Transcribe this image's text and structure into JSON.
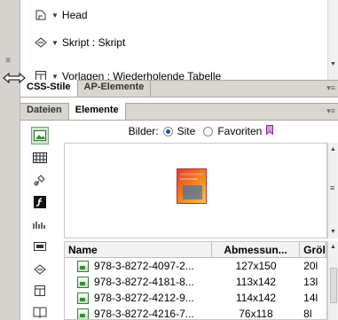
{
  "top_panel": {
    "rows": [
      {
        "icon": "head-tag-icon",
        "label": "Head"
      },
      {
        "icon": "script-icon",
        "label": "Skript : Skript"
      },
      {
        "icon": "template-icon",
        "label": "Vorlagen : Wiederholende Tabelle"
      }
    ]
  },
  "tabs_group1": [
    {
      "label": "CSS-Stile",
      "active": true
    },
    {
      "label": "AP-Elemente",
      "active": false
    }
  ],
  "tabs_group2": [
    {
      "label": "Dateien",
      "active": false
    },
    {
      "label": "Elemente",
      "active": true
    }
  ],
  "assets": {
    "label": "Bilder:",
    "radio_site": "Site",
    "radio_favorites": "Favoriten",
    "selected": "Site",
    "columns": [
      "Name",
      "Abmessun...",
      "Gröl"
    ],
    "rows": [
      {
        "name": "978-3-8272-4097-2...",
        "dims": "127x150",
        "size": "20l"
      },
      {
        "name": "978-3-8272-4181-8...",
        "dims": "113x142",
        "size": "13l"
      },
      {
        "name": "978-3-8272-4212-9...",
        "dims": "114x142",
        "size": "14l"
      },
      {
        "name": "978-3-8272-4216-7...",
        "dims": "76x118",
        "size": "8l"
      }
    ]
  },
  "side_tools": [
    "images-icon",
    "colors-icon",
    "urls-icon",
    "flash-icon",
    "shockwave-icon",
    "movies-icon",
    "scripts-icon",
    "templates-icon",
    "library-icon"
  ],
  "colors": {
    "accent": "#1f4fa8",
    "tab_bar": "#d9d6d0",
    "favorites": "#b03bb0"
  }
}
